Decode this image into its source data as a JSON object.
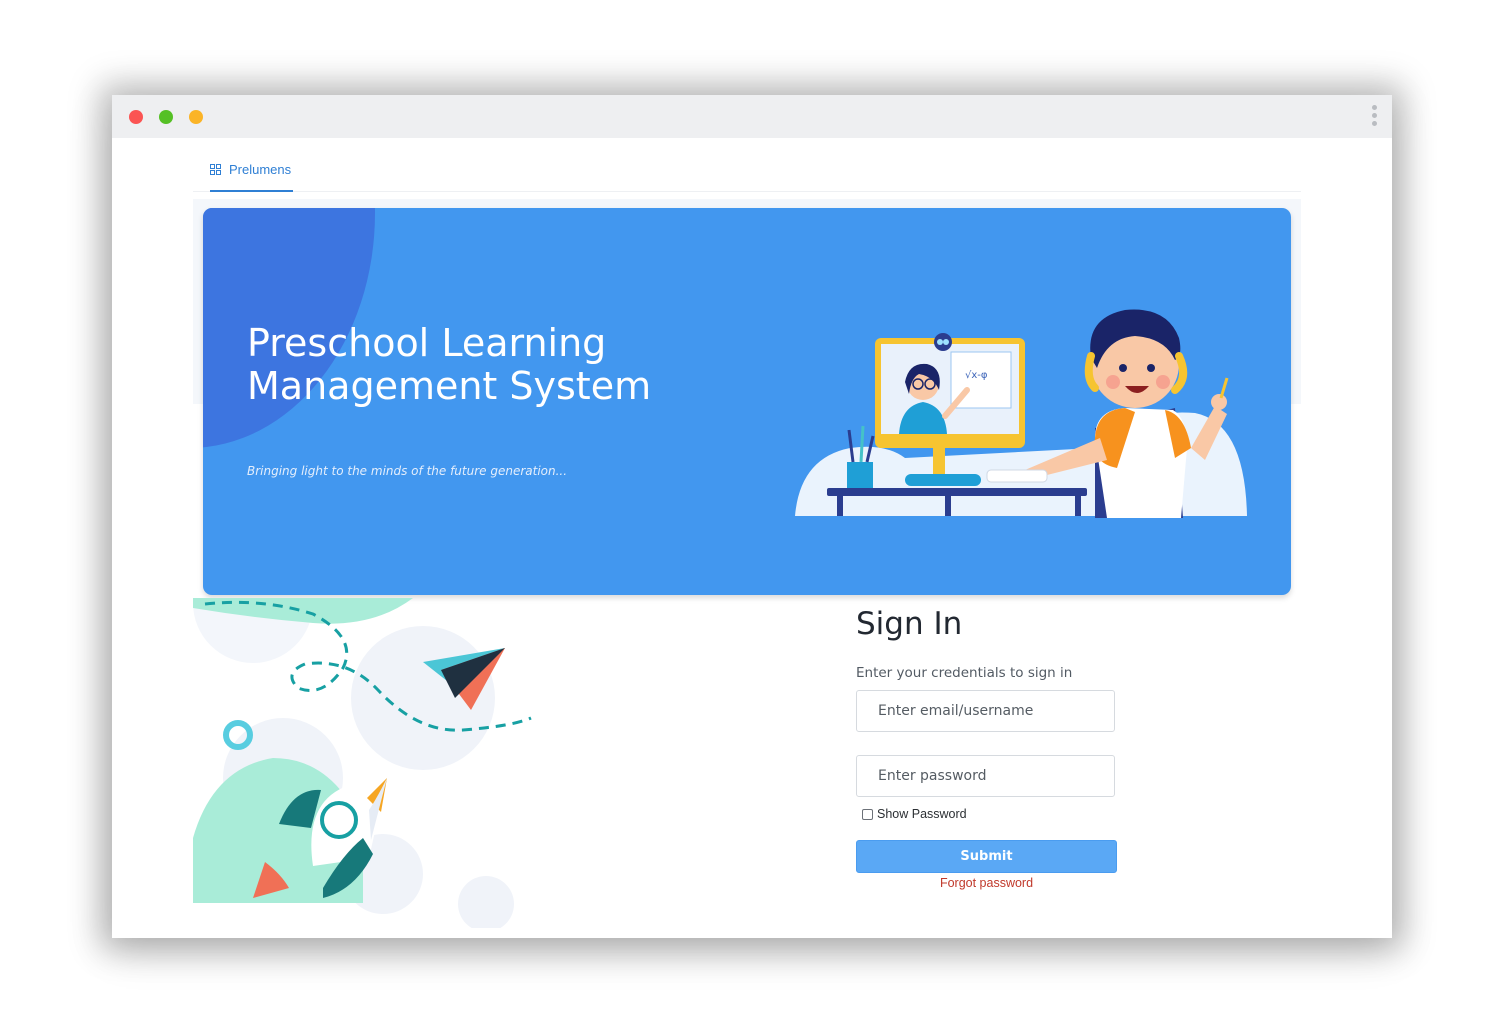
{
  "window": {
    "controls": [
      "close",
      "zoom",
      "minimize"
    ],
    "menu_icon": "kebab-icon"
  },
  "nav": {
    "brand_icon": "grid-icon",
    "brand_label": "Prelumens"
  },
  "hero": {
    "title": "Preschool Learning Management System",
    "subtitle": "Bringing light to the minds of the future generation..."
  },
  "signin": {
    "title": "Sign In",
    "description": "Enter your credentials to sign in",
    "email_placeholder": "Enter email/username",
    "password_placeholder": "Enter password",
    "show_password_label": "Show Password",
    "show_password_checked": false,
    "submit_label": "Submit",
    "forgot_label": "Forgot password"
  },
  "colors": {
    "accent": "#4297ef",
    "submit": "#5aa8f5",
    "link": "#c0392b"
  }
}
